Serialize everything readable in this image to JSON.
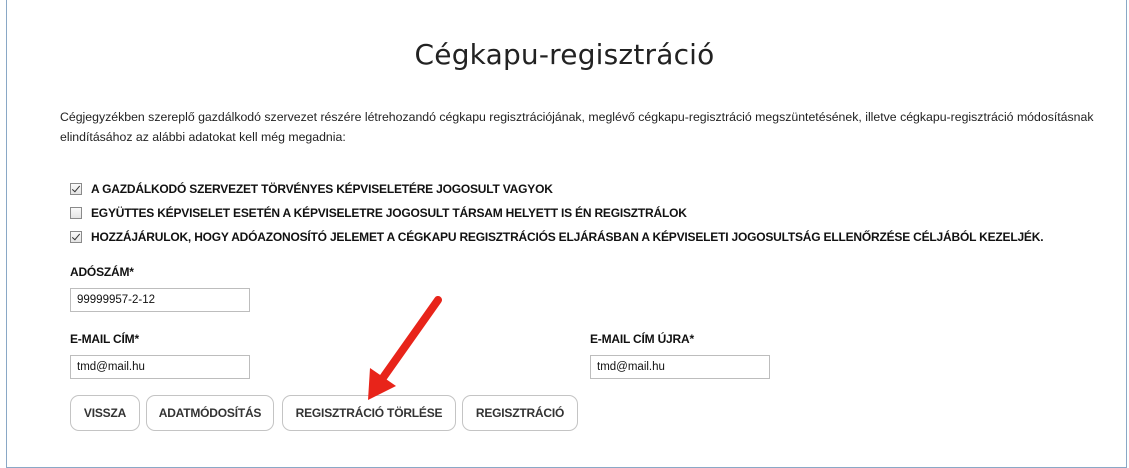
{
  "page": {
    "title": "Cégkapu-regisztráció",
    "intro": "Cégjegyzékben szereplő gazdálkodó szervezet részére létrehozandó cégkapu regisztrációjának, meglévő cégkapu-regisztráció megszüntetésének, illetve cégkapu-regisztráció módosításnak elindításához az alábbi adatokat kell még megadnia:"
  },
  "checkboxes": [
    {
      "label": "A gazdálkodó szervezet törvényes képviseletére jogosult vagyok",
      "checked": true
    },
    {
      "label": "Együttes képviselet esetén a képviseletre jogosult társam helyett is én regisztrálok",
      "checked": false
    },
    {
      "label": "Hozzájárulok, hogy adóazonosító jelemet a cégkapu regisztrációs eljárásban a képviseleti jogosultság ellenőrzése céljából kezeljék.",
      "checked": true
    }
  ],
  "fields": {
    "adoszam": {
      "label": "ADÓSZÁM*",
      "value": "99999957-2-12"
    },
    "email": {
      "label": "E-MAIL CÍM*",
      "value": "tmd@mail.hu"
    },
    "email_again": {
      "label": "E-MAIL CÍM ÚJRA*",
      "value": "tmd@mail.hu"
    }
  },
  "buttons": {
    "back": "VISSZA",
    "modify": "ADATMÓDOSÍTÁS",
    "delete": "REGISZTRÁCIÓ TÖRLÉSE",
    "register": "REGISZTRÁCIÓ"
  },
  "annotation": {
    "arrow_color": "#e8241a"
  }
}
